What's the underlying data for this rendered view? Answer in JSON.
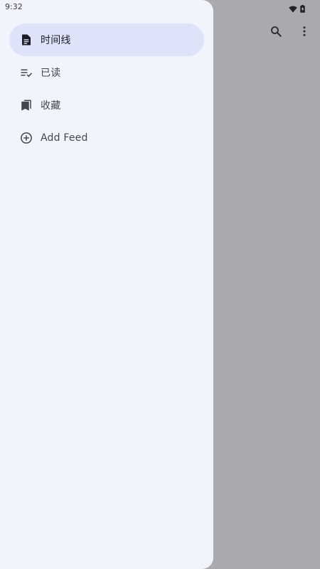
{
  "status_bar": {
    "time": "9:32",
    "icons": [
      "wifi-icon",
      "battery-icon"
    ]
  },
  "toolbar": {
    "icons": [
      "search-icon",
      "more-vert-icon"
    ]
  },
  "drawer": {
    "items": [
      {
        "label": "时间线",
        "icon": "article-icon",
        "active": true
      },
      {
        "label": "已读",
        "icon": "playlist-check-icon",
        "active": false
      },
      {
        "label": "收藏",
        "icon": "bookmarks-icon",
        "active": false
      },
      {
        "label": "Add Feed",
        "icon": "add-circle-icon",
        "active": false
      }
    ]
  },
  "colors": {
    "drawer_bg": "#f1f3fd",
    "active_item_bg": "#dfe3f9",
    "scrim_bg": "#a9aaad",
    "icon_color": "#44464f",
    "active_icon_color": "#1a1c23"
  }
}
